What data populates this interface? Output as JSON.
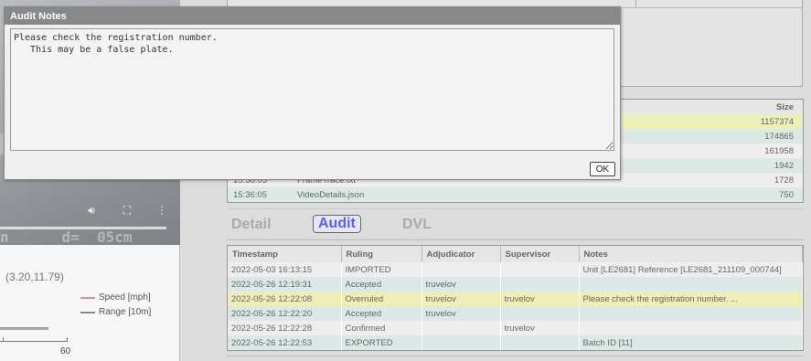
{
  "video": {
    "overlay_text": "n      d=  05cm",
    "controls": {
      "volume_icon": "volume-icon",
      "fullscreen_icon": "fullscreen-icon",
      "more_icon": "more-vert-icon"
    }
  },
  "graph": {
    "coordinate_readout": "(3.20,11.79)",
    "x_tick_label": "60",
    "legend": [
      {
        "label": "Speed [mph]",
        "color": "#e08a90"
      },
      {
        "label": "Range [10m]",
        "color": "#888888"
      }
    ]
  },
  "files": {
    "headers": {
      "size": "Size"
    },
    "rows": [
      {
        "time": "",
        "name": "",
        "size": "1157374",
        "style": "hl"
      },
      {
        "time": "",
        "name": "",
        "size": "174865",
        "style": "alt"
      },
      {
        "time": "",
        "name": "",
        "size": "161958",
        "style": "plain"
      },
      {
        "time": "",
        "name": "",
        "size": "1942",
        "style": "alt"
      },
      {
        "time": "15:36:05",
        "name": "FrameTrace.txt",
        "size": "1728",
        "style": "plain"
      },
      {
        "time": "15:36:05",
        "name": "VideoDetails.json",
        "size": "750",
        "style": "alt"
      }
    ]
  },
  "tabs": [
    {
      "label": "Detail",
      "active": false
    },
    {
      "label": "Audit",
      "active": true
    },
    {
      "label": "DVL",
      "active": false
    }
  ],
  "audit": {
    "headers": [
      "Timestamp",
      "Ruling",
      "Adjudicator",
      "Supervisor",
      "Notes"
    ],
    "rows": [
      {
        "timestamp": "2022-05-03 16:13:15",
        "ruling": "IMPORTED",
        "adjudicator": "",
        "supervisor": "",
        "notes": "Unit [LE2681] Reference [LE2681_211109_000744]",
        "style": "plain"
      },
      {
        "timestamp": "2022-05-26 12:19:31",
        "ruling": "Accepted",
        "adjudicator": "truvelov",
        "supervisor": "",
        "notes": "",
        "style": "alt"
      },
      {
        "timestamp": "2022-05-26 12:22:08",
        "ruling": "Overruled",
        "adjudicator": "truvelov",
        "supervisor": "truvelov",
        "notes": "Please check the registration number. ...",
        "style": "hl"
      },
      {
        "timestamp": "2022-05-26 12:22:20",
        "ruling": "Accepted",
        "adjudicator": "truvelov",
        "supervisor": "",
        "notes": "",
        "style": "alt"
      },
      {
        "timestamp": "2022-05-26 12:22:28",
        "ruling": "Confirmed",
        "adjudicator": "",
        "supervisor": "truvelov",
        "notes": "",
        "style": "plain"
      },
      {
        "timestamp": "2022-05-26 12:22:53",
        "ruling": "EXPORTED",
        "adjudicator": "",
        "supervisor": "",
        "notes": "Batch ID [11]",
        "style": "alt"
      }
    ]
  },
  "modal": {
    "title": "Audit Notes",
    "note_text": "Please check the registration number.\n   This may be a false plate.",
    "ok_label": "OK"
  }
}
